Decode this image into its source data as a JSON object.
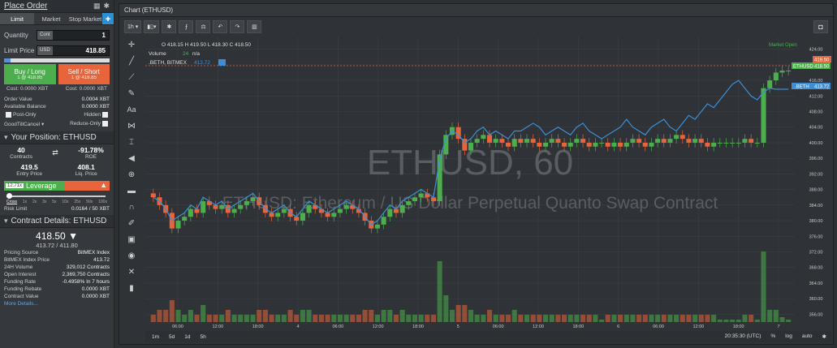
{
  "order": {
    "title": "Place Order",
    "tabs": [
      "Limit",
      "Market",
      "Stop Market"
    ],
    "quantity": {
      "label": "Quantity",
      "tag": "Cont",
      "value": "1"
    },
    "limit_price": {
      "label": "Limit Price",
      "tag": "USD",
      "value": "418.85"
    },
    "buy": {
      "label": "Buy / Long",
      "sub": "1 @ 418.85"
    },
    "sell": {
      "label": "Sell / Short",
      "sub": "1 @ 418.85"
    },
    "cost_buy": "Cost: 0.0000 XBT",
    "cost_sell": "Cost: 0.0000 XBT",
    "order_value": {
      "k": "Order Value",
      "v": "0.0004 XBT"
    },
    "available": {
      "k": "Available Balance",
      "v": "0.0000 XBT"
    },
    "post_only": "Post-Only",
    "hidden": "Hidden",
    "gtc": "GoodTillCancel",
    "reduce": "Reduce-Only"
  },
  "position": {
    "title": "Your Position: ETHUSD",
    "contracts": {
      "num": "40",
      "cap": "Contracts"
    },
    "roe": {
      "num": "-91.78%",
      "cap": "ROE"
    },
    "entry": {
      "num": "419.5",
      "cap": "Entry Price"
    },
    "liq": {
      "num": "408.1",
      "cap": "Liq. Price"
    },
    "leverage_badge": "12.71x",
    "leverage_label": "Leverage",
    "ticks": [
      "Cross",
      "1x",
      "2x",
      "3x",
      "5x",
      "10x",
      "25x",
      "50x",
      "100x"
    ],
    "risk": {
      "k": "Risk Limit",
      "v": "0.0164 / 50 XBT"
    }
  },
  "contract": {
    "title": "Contract Details: ETHUSD",
    "price": "418.50",
    "sub": "413.72 / 411.80",
    "rows": [
      {
        "k": "Pricing Source",
        "v": "BitMEX Index"
      },
      {
        "k": "BitMEX Index Price",
        "v": "413.72"
      },
      {
        "k": "24H Volume",
        "v": "329,012 Contracts"
      },
      {
        "k": "Open Interest",
        "v": "2,369,750 Contracts"
      },
      {
        "k": "Funding Rate",
        "v": "-0.4958% In 7 hours"
      },
      {
        "k": "Funding Rebate",
        "v": "0.0000 XBT"
      },
      {
        "k": "Contract Value",
        "v": "0.0000 XBT"
      }
    ],
    "more": "More Details..."
  },
  "chart": {
    "panel_title": "Chart (ETHUSD)",
    "interval": "1h",
    "ohlc": "O 418.15 H 419.50 L 418.30 C 418.50",
    "volume": "Volume",
    "volume_val": "24",
    "volume_na": "n/a",
    "index": ".BETH, BITMEX",
    "index_val": "413.72",
    "market_status": "Market Open",
    "watermark_big": "ETHUSD, 60",
    "watermark_small": "ETHUSD: Ethereum / US Dollar Perpetual Quanto Swap Contract",
    "label_eth": "ETHUSD",
    "label_eth_val": "418.50",
    "label_eth_last": "419.50",
    "label_beth": ".BETH",
    "label_beth_val": "413.72",
    "y_ticks": [
      "424.00",
      "420.00",
      "416.00",
      "412.00",
      "408.00",
      "404.00",
      "400.00",
      "396.00",
      "392.00",
      "388.00",
      "384.00",
      "380.00",
      "376.00",
      "372.00",
      "368.00",
      "364.00",
      "360.00",
      "356.00"
    ],
    "x_ticks": [
      "06:00",
      "12:00",
      "18:00",
      "4",
      "06:00",
      "12:00",
      "18:00",
      "5",
      "06:00",
      "12:00",
      "18:00",
      "6",
      "06:00",
      "12:00",
      "18:00",
      "7"
    ],
    "ranges": [
      "1m",
      "5d",
      "1d",
      "5h"
    ],
    "clock": "20:35:30 (UTC)",
    "scale_opts": [
      "%",
      "log",
      "auto"
    ],
    "colors": {
      "up": "#4cae4c",
      "down": "#e8643a",
      "index": "#3c8fd6"
    }
  },
  "chart_data": {
    "type": "candlestick",
    "title": "ETHUSD, 60",
    "ylim": [
      354,
      426
    ],
    "x_ticks": [
      "06:00",
      "12:00",
      "18:00",
      "4",
      "06:00",
      "12:00",
      "18:00",
      "5",
      "06:00",
      "12:00",
      "18:00",
      "6",
      "06:00",
      "12:00",
      "18:00",
      "7"
    ],
    "close": [
      386,
      384,
      382,
      378,
      380,
      381,
      383,
      382,
      385,
      384,
      383,
      384,
      382,
      383,
      384,
      385,
      386,
      384,
      382,
      381,
      382,
      383,
      381,
      380,
      382,
      384,
      383,
      382,
      381,
      382,
      383,
      384,
      383,
      382,
      380,
      378,
      379,
      381,
      383,
      382,
      384,
      385,
      386,
      387,
      386,
      385,
      397,
      402,
      404,
      401,
      398,
      400,
      401,
      402,
      400,
      401,
      400,
      399,
      401,
      400,
      401,
      400,
      399,
      400,
      401,
      400,
      399,
      400,
      401,
      400,
      399,
      400,
      400,
      399,
      400,
      399,
      400,
      401,
      400,
      399,
      400,
      401,
      400,
      401,
      402,
      401,
      400,
      401,
      400,
      399,
      400,
      400,
      400,
      400,
      400,
      401,
      400,
      400,
      414,
      416,
      418,
      418.5,
      418.5
    ],
    "index": [
      386,
      385,
      383,
      380,
      381,
      382,
      384,
      383,
      386,
      385,
      384,
      385,
      383,
      384,
      385,
      386,
      387,
      385,
      383,
      382,
      383,
      384,
      382,
      381,
      383,
      385,
      384,
      383,
      382,
      383,
      384,
      385,
      384,
      383,
      381,
      379,
      380,
      382,
      384,
      383,
      385,
      386,
      387,
      388,
      387,
      386,
      396,
      401,
      403,
      402,
      400,
      401,
      403,
      404,
      402,
      403,
      402,
      401,
      403,
      403,
      404,
      405,
      404,
      402,
      403,
      404,
      403,
      402,
      404,
      405,
      403,
      402,
      401,
      402,
      403,
      404,
      406,
      404,
      403,
      402,
      404,
      405,
      406,
      404,
      403,
      405,
      407,
      406,
      408,
      410,
      409,
      411,
      413,
      415,
      416,
      414,
      412,
      411,
      413,
      414,
      413.72,
      413.72,
      413.72
    ]
  }
}
